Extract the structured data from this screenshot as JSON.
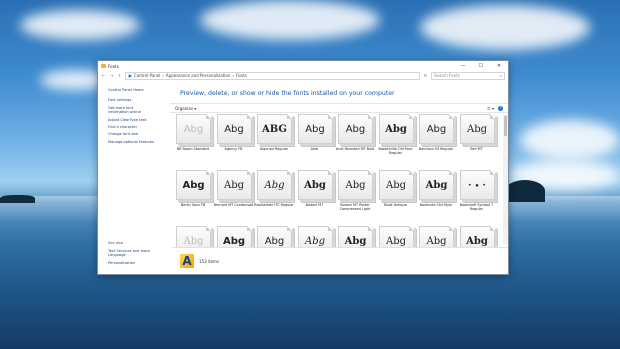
{
  "window": {
    "title": "Fonts"
  },
  "address": {
    "breadcrumbs": [
      "Control Panel",
      "Appearance and Personalization",
      "Fonts"
    ],
    "search_placeholder": "Search Fonts"
  },
  "sidebar": {
    "items": [
      {
        "label": "Control Panel Home"
      },
      {
        "label": "Font settings"
      },
      {
        "label": "Get more font information online"
      },
      {
        "label": "Adjust ClearType text"
      },
      {
        "label": "Find a character"
      },
      {
        "label": "Change font size"
      },
      {
        "label": "Manage optional features"
      }
    ],
    "see_also": "See also",
    "see_also_items": [
      {
        "label": "Text Services and Input Language"
      },
      {
        "label": "Personalization"
      }
    ]
  },
  "main": {
    "heading": "Preview, delete, or show or hide the fonts installed on your computer",
    "toolbar": {
      "organize": "Organize"
    }
  },
  "fonts": [
    {
      "sample": "Abg",
      "label": "8R Naam Standard",
      "style": "sans",
      "light": true
    },
    {
      "sample": "Abg",
      "label": "Agency FB",
      "style": "sans",
      "light": false
    },
    {
      "sample": "ABG",
      "label": "Algerian Regular",
      "style": "serif",
      "light": false
    },
    {
      "sample": "Abg",
      "label": "Arial",
      "style": "sans",
      "light": false
    },
    {
      "sample": "Abg",
      "label": "Arial Rounded MT Bold",
      "style": "sans",
      "light": false
    },
    {
      "sample": "Abg",
      "label": "Baskerville Old Face Regular",
      "style": "serif",
      "light": false
    },
    {
      "sample": "Abg",
      "label": "Bauhaus 93 Regular",
      "style": "sans",
      "light": false
    },
    {
      "sample": "Abg",
      "label": "Bell MT",
      "style": "serif",
      "light": false
    },
    {
      "sample": "Abg",
      "label": "Berlin Sans FB",
      "style": "sans",
      "light": false
    },
    {
      "sample": "Abg",
      "label": "Bernard MT Condensed",
      "style": "serif",
      "light": false
    },
    {
      "sample": "Abg",
      "label": "Blackadder ITC Regular",
      "style": "serif",
      "light": false
    },
    {
      "sample": "Abg",
      "label": "Bodoni MT",
      "style": "serif",
      "light": false
    },
    {
      "sample": "Abg",
      "label": "Bodoni MT Poster Compressed Light",
      "style": "serif",
      "light": false
    },
    {
      "sample": "Abg",
      "label": "Book Antiqua",
      "style": "serif",
      "light": false
    },
    {
      "sample": "Abg",
      "label": "Bookman Old Style",
      "style": "serif",
      "light": false
    },
    {
      "sample": "• ▪ •",
      "label": "Bookshelf Symbol 7 Regular",
      "style": "mono",
      "light": false
    },
    {
      "sample": "Abg",
      "label": "",
      "style": "serif",
      "light": true
    },
    {
      "sample": "Abg",
      "label": "",
      "style": "sans",
      "light": false
    },
    {
      "sample": "Abg",
      "label": "",
      "style": "sans",
      "light": false
    },
    {
      "sample": "Abg",
      "label": "",
      "style": "serif",
      "light": false
    },
    {
      "sample": "Abg",
      "label": "",
      "style": "serif",
      "light": false
    },
    {
      "sample": "Abg",
      "label": "",
      "style": "serif",
      "light": false
    },
    {
      "sample": "Abg",
      "label": "",
      "style": "serif",
      "light": false
    },
    {
      "sample": "Abg",
      "label": "",
      "style": "serif",
      "light": false
    }
  ],
  "status": {
    "count": "153 items",
    "icon_glyph": "A"
  }
}
